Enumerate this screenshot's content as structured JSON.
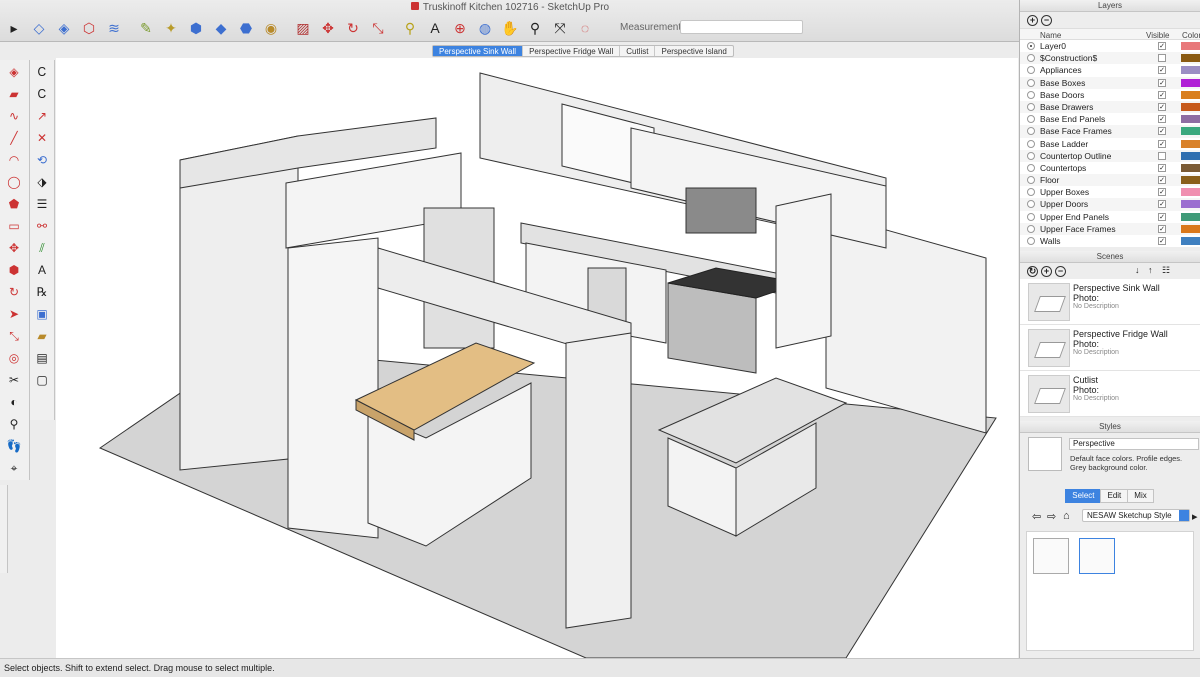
{
  "window": {
    "title": "Truskinoff Kitchen 102716 - SketchUp Pro"
  },
  "toolbar": {
    "items": [
      {
        "name": "select-tool-icon"
      },
      {
        "name": "eraser-tool-icon"
      },
      {
        "name": "paint-bucket-icon"
      },
      {
        "name": "component-icon"
      },
      {
        "name": "pencil-icon"
      },
      {
        "name": "sandbox-icon"
      },
      {
        "name": "push-pull-icon"
      },
      {
        "name": "move-icon"
      },
      {
        "name": "rotate-icon"
      },
      {
        "name": "scale-icon"
      },
      {
        "name": "tape-measure-icon"
      },
      {
        "name": "text-icon"
      },
      {
        "name": "axes-icon"
      },
      {
        "name": "orbit-icon"
      },
      {
        "name": "pan-icon"
      },
      {
        "name": "zoom-icon"
      },
      {
        "name": "zoom-extents-icon"
      },
      {
        "name": "section-plane-icon"
      }
    ],
    "measurements_label": "Measurements",
    "measurements_value": ""
  },
  "scene_tabs": [
    {
      "label": "Perspective Sink Wall",
      "active": true
    },
    {
      "label": "Perspective Fridge Wall",
      "active": false
    },
    {
      "label": "Cutlist",
      "active": false
    },
    {
      "label": "Perspective Island",
      "active": false
    }
  ],
  "layers": {
    "title": "Layers",
    "columns": {
      "name": "Name",
      "visible": "Visible",
      "color": "Color"
    },
    "rows": [
      {
        "name": "Layer0",
        "active": true,
        "visible": true,
        "color": "#e8787a"
      },
      {
        "name": "$Construction$",
        "active": false,
        "visible": false,
        "color": "#8a5a12"
      },
      {
        "name": "Appliances",
        "active": false,
        "visible": true,
        "color": "#9b8ec4"
      },
      {
        "name": "Base Boxes",
        "active": false,
        "visible": true,
        "color": "#b01fd6"
      },
      {
        "name": "Base Doors",
        "active": false,
        "visible": true,
        "color": "#d97f1e"
      },
      {
        "name": "Base Drawers",
        "active": false,
        "visible": true,
        "color": "#c75a1c"
      },
      {
        "name": "Base End Panels",
        "active": false,
        "visible": true,
        "color": "#8e6da3"
      },
      {
        "name": "Base Face Frames",
        "active": false,
        "visible": true,
        "color": "#3aa87e"
      },
      {
        "name": "Base Ladder",
        "active": false,
        "visible": true,
        "color": "#d9822b"
      },
      {
        "name": "Countertop Outline",
        "active": false,
        "visible": false,
        "color": "#2f6fb0"
      },
      {
        "name": "Countertops",
        "active": false,
        "visible": true,
        "color": "#7a5a34"
      },
      {
        "name": "Floor",
        "active": false,
        "visible": true,
        "color": "#8a5f1a"
      },
      {
        "name": "Upper Boxes",
        "active": false,
        "visible": true,
        "color": "#f08fb0"
      },
      {
        "name": "Upper Doors",
        "active": false,
        "visible": true,
        "color": "#9b6ed0"
      },
      {
        "name": "Upper End Panels",
        "active": false,
        "visible": true,
        "color": "#3f9a78"
      },
      {
        "name": "Upper Face Frames",
        "active": false,
        "visible": true,
        "color": "#d9781c"
      },
      {
        "name": "Walls",
        "active": false,
        "visible": true,
        "color": "#3f80c0"
      }
    ]
  },
  "scenes": {
    "title": "Scenes",
    "items": [
      {
        "name": "Perspective Sink Wall",
        "photo": "Photo:",
        "description": "No Description"
      },
      {
        "name": "Perspective Fridge Wall",
        "photo": "Photo:",
        "description": "No Description"
      },
      {
        "name": "Cutlist",
        "photo": "Photo:",
        "description": "No Description"
      }
    ]
  },
  "styles": {
    "title": "Styles",
    "name": "Perspective",
    "description": "Default face colors. Profile edges. Grey background color.",
    "tabs": [
      {
        "label": "Select",
        "active": true
      },
      {
        "label": "Edit",
        "active": false
      },
      {
        "label": "Mix",
        "active": false
      }
    ],
    "library": "NESAW Sketchup Style"
  },
  "status": {
    "text": "Select objects. Shift to extend select. Drag mouse to select multiple."
  },
  "colors": {
    "accent": "#3d83e0",
    "floor": "#d4d4d4",
    "wall": "#eeeeee",
    "countertop": "#e3be84"
  }
}
